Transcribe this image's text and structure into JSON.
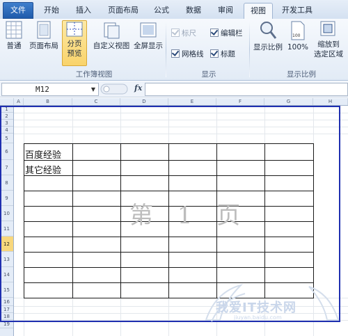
{
  "tabs": [
    {
      "label": "文件"
    },
    {
      "label": "开始"
    },
    {
      "label": "插入"
    },
    {
      "label": "页面布局"
    },
    {
      "label": "公式"
    },
    {
      "label": "数据"
    },
    {
      "label": "审阅"
    },
    {
      "label": "视图"
    },
    {
      "label": "开发工具"
    }
  ],
  "active_tab": "视图",
  "ribbon": {
    "workbook_views": {
      "group_label": "工作簿视图",
      "normal": "普通",
      "page_layout": "页面布局",
      "page_break_preview_1": "分页",
      "page_break_preview_2": "预览",
      "custom_views": "自定义视图",
      "full_screen": "全屏显示"
    },
    "show": {
      "group_label": "显示",
      "ruler": "标尺",
      "formula_bar": "编辑栏",
      "gridlines": "网格线",
      "headings": "标题"
    },
    "zoom": {
      "group_label": "显示比例",
      "zoom": "显示比例",
      "hundred": "100%",
      "zoom_to_selection_1": "缩放到",
      "zoom_to_selection_2": "选定区域"
    }
  },
  "formula_bar": {
    "name_box": "M12",
    "fx_label": "fx",
    "formula": ""
  },
  "sheet": {
    "columns": [
      "A",
      "B",
      "C",
      "D",
      "E",
      "F",
      "G",
      "H"
    ],
    "rows": [
      "1",
      "2",
      "3",
      "4",
      "5",
      "6",
      "7",
      "8",
      "9",
      "10",
      "11",
      "12",
      "13",
      "14",
      "15",
      "16",
      "17",
      "18",
      "19"
    ],
    "selected_row": "12",
    "cells": {
      "b6": "百度经验",
      "b7": "其它经验"
    },
    "page_watermark": "第 1 页"
  },
  "brand": {
    "text": "我爱IT技术网",
    "sub": "jiuyan.baidu.com"
  },
  "colors": {
    "accent_blue": "#1f5bab",
    "selected_button": "#f9d36b",
    "page_border": "#1f2fb0"
  }
}
